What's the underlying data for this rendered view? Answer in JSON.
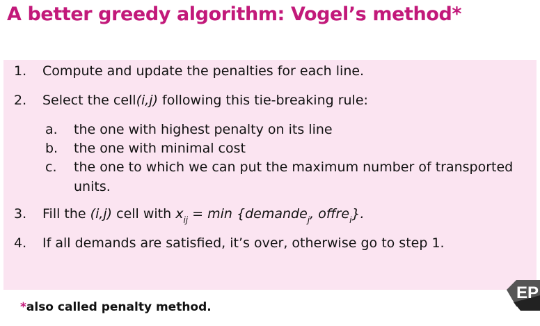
{
  "title": "A better greedy algorithm: Vogel’s method*",
  "steps": [
    {
      "num": "1.",
      "text": "Compute and update the penalties for each line."
    },
    {
      "num": "2.",
      "text_a": "Select the cell",
      "text_it": "(i,j)",
      "text_b": " following this tie-breaking rule:"
    },
    {
      "num": "3.",
      "text_a": "Fill the ",
      "text_it": "(i,j)",
      "text_b": " cell with ",
      "x": "x",
      "ij": "ij",
      "eq": " = min {demande",
      "j": "j",
      "comma": ", offre",
      "i": "i",
      "close": "}."
    },
    {
      "num": "4.",
      "text": "If all demands are satisfied, it’s over, otherwise go to step 1."
    }
  ],
  "substeps": [
    {
      "letter": "a.",
      "text": "the one with highest penalty on its line"
    },
    {
      "letter": "b.",
      "text": "the one with minimal cost"
    },
    {
      "letter": "c.",
      "text1": "the one to which we can put the maximum number of transported",
      "text2": "units."
    }
  ],
  "footnote": {
    "star": "*",
    "text": "also called penalty method."
  },
  "logo": {
    "text": "EP",
    "color": "#555555"
  },
  "colors": {
    "accent": "#c2197a",
    "panel": "#fbe4f1"
  }
}
